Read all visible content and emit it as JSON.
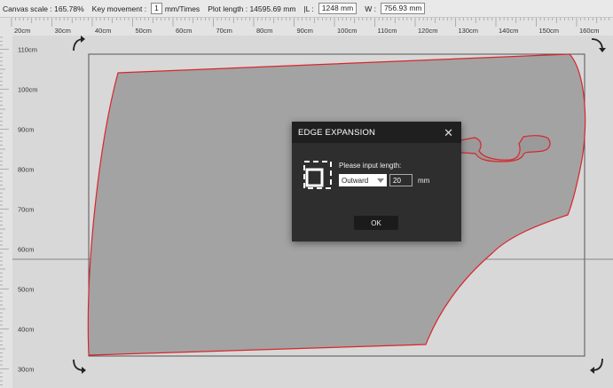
{
  "status": {
    "canvas_scale_label": "Canvas scale : 165.78%",
    "key_movement_label": "Key movement :",
    "key_movement_value": "1",
    "key_movement_unit": "mm/Times",
    "plot_length": "Plot length : 14595.69 mm",
    "l_label": "|L :",
    "l_value": "1248 mm",
    "w_label": "W :",
    "w_value": "756.93 mm"
  },
  "ruler": {
    "x_labels": [
      "20cm",
      "30cm",
      "40cm",
      "50cm",
      "60cm",
      "70cm",
      "80cm",
      "90cm",
      "100cm",
      "110cm",
      "120cm",
      "130cm",
      "140cm",
      "150cm",
      "160cm"
    ],
    "y_labels": [
      "110cm",
      "100cm",
      "90cm",
      "80cm",
      "70cm",
      "60cm",
      "50cm",
      "40cm",
      "30cm"
    ]
  },
  "colors": {
    "background": "#d8d8d8",
    "piece_fill": "#a3a3a3",
    "piece_outline": "#d9262c",
    "dialog_bg": "#2e2e2e"
  },
  "icons": [
    "rotate-top-left-icon",
    "rotate-top-right-icon",
    "rotate-bottom-left-icon",
    "rotate-bottom-right-icon",
    "edge-expansion-icon",
    "close-icon",
    "dropdown-caret-icon"
  ],
  "dialog": {
    "title": "EDGE EXPANSION",
    "close_glyph": "✕",
    "prompt": "Please input length:",
    "direction": "Outward",
    "length_value": "20",
    "unit": "mm",
    "ok_label": "OK"
  }
}
